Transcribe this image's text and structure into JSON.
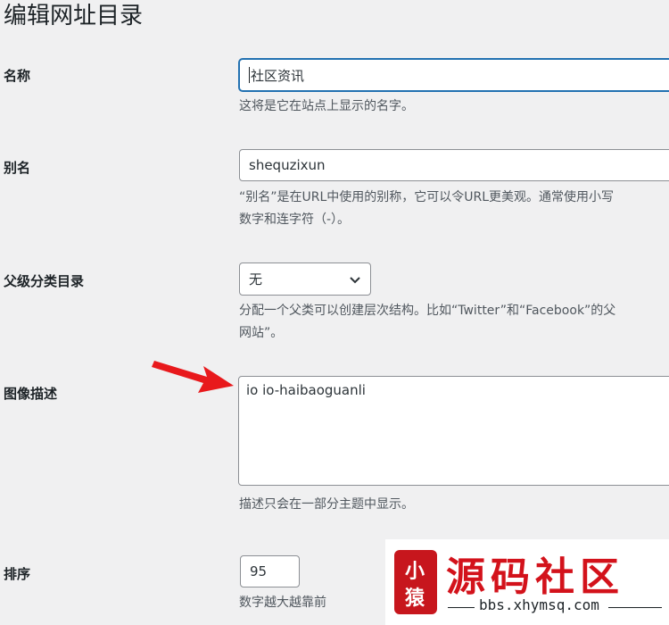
{
  "page_title": "编辑网址目录",
  "fields": {
    "name": {
      "label": "名称",
      "value": "社区资讯",
      "desc": "这将是它在站点上显示的名字。"
    },
    "slug": {
      "label": "别名",
      "value": "shequzixun",
      "desc_line1": "“别名”是在URL中使用的别称，它可以令URL更美观。通常使用小写",
      "desc_line2": "数字和连字符（-）。"
    },
    "parent": {
      "label": "父级分类目录",
      "selected": "无",
      "desc_line1": "分配一个父类可以创建层次结构。比如“Twitter”和“Facebook”的父",
      "desc_line2": "网站”。"
    },
    "image_desc": {
      "label": "图像描述",
      "value": "io io-haibaoguanli",
      "desc": "描述只会在一部分主题中显示。"
    },
    "order": {
      "label": "排序",
      "value": "95",
      "desc": "数字越大越靠前"
    }
  },
  "watermark": {
    "seal_text_1": "小",
    "seal_text_2": "猿",
    "title": "源码社区",
    "url": "bbs.xhymsq.com"
  },
  "colors": {
    "background": "#f0f0f1",
    "focus": "#2271b1",
    "arrow": "#e8191c",
    "watermark_red": "#d3121b"
  },
  "icons": {
    "select_chevron": "chevron-down-icon",
    "annotation_arrow": "arrow-icon"
  }
}
